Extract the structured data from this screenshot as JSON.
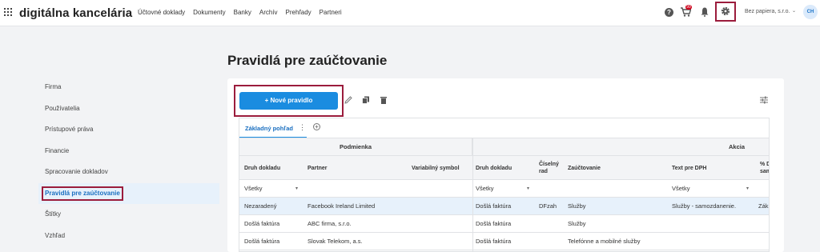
{
  "app": {
    "logo": "digitálna kancelária"
  },
  "nav": [
    "Účtovné doklady",
    "Dokumenty",
    "Banky",
    "Archív",
    "Prehľady",
    "Partneri"
  ],
  "header": {
    "company": "Bez papiera, s.r.o.",
    "avatar": "CH",
    "help_glyph": "?",
    "cart_badge": "99",
    "icons": [
      "grid-icon",
      "help-icon",
      "cart-icon",
      "bell-icon",
      "gear-icon"
    ]
  },
  "page": {
    "title": "Pravidlá pre zaúčtovanie"
  },
  "sidebar": {
    "items": [
      "Firma",
      "Používatelia",
      "Prístupové práva",
      "Financie",
      "Spracovanie dokladov",
      "Pravidlá pre zaúčtovanie",
      "Štítky",
      "Vzhľad"
    ],
    "active": "Pravidlá pre zaúčtovanie"
  },
  "toolbar": {
    "new_rule": "+   Nové pravidlo",
    "icons": [
      "edit-icon",
      "copy-icon",
      "delete-icon",
      "filter-settings-icon"
    ]
  },
  "tabs": {
    "active": "Základný pohľad",
    "kebab": "⋮",
    "add": "+"
  },
  "table": {
    "group_condition": "Podmienka",
    "group_action": "Akcia",
    "columns": {
      "doc_type": "Druh dokladu",
      "partner": "Partner",
      "var_symbol": "Variabilný symbol",
      "doc_type2": "Druh dokladu",
      "number_series_1": "Číselný",
      "number_series_2": "rad",
      "accounting": "Zaúčtovanie",
      "vat_text": "Text pre DPH",
      "pct_1": "% D",
      "pct_2": "sam"
    },
    "filters": {
      "doc_type": "Všetky",
      "doc_type2": "Všetky",
      "vat_text": "Všetky",
      "dropdown_glyph": "▾"
    },
    "rows": [
      {
        "doc_type": "Nezaradený",
        "partner": "Facebook Ireland Limited",
        "var_symbol": "",
        "doc_type2": "Došlá faktúra",
        "series": "DFzah",
        "accounting": "Služby",
        "vat_text": "Služby - samozdanenie.",
        "pct": "Zákl"
      },
      {
        "doc_type": "Došlá faktúra",
        "partner": "ABC firma, s.r.o.",
        "var_symbol": "",
        "doc_type2": "Došlá faktúra",
        "series": "",
        "accounting": "Služby",
        "vat_text": "",
        "pct": ""
      },
      {
        "doc_type": "Došlá faktúra",
        "partner": "Slovak Telekom, a.s.",
        "var_symbol": "",
        "doc_type2": "Došlá faktúra",
        "series": "",
        "accounting": "Telefónne a mobilné služby",
        "vat_text": "",
        "pct": ""
      }
    ]
  }
}
